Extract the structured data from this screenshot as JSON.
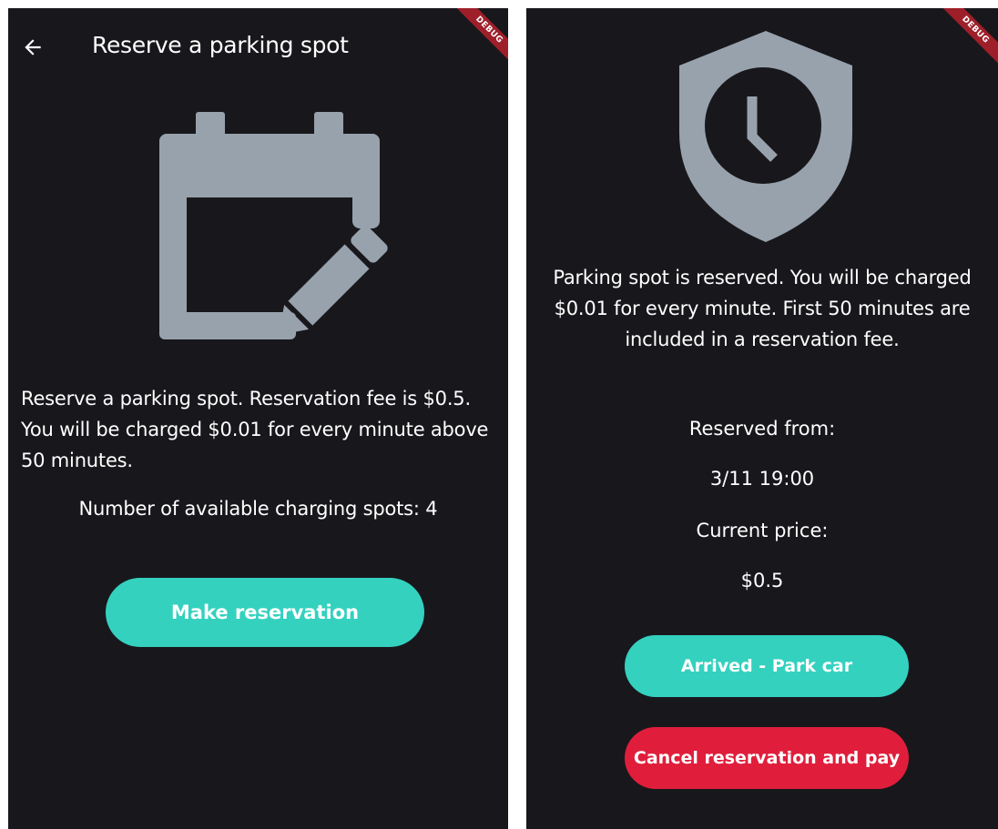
{
  "left_screen": {
    "debug_banner": "DEBUG",
    "title": "Reserve a parking spot",
    "description": "Reserve a parking spot. Reservation fee is $0.5. You will be charged $0.01 for every minute above 50 minutes.",
    "available_spots": "Number of available charging spots: 4",
    "make_reservation_label": "Make reservation",
    "icons": {
      "back": "arrow-back-icon",
      "hero": "calendar-edit-icon"
    }
  },
  "right_screen": {
    "debug_banner": "DEBUG",
    "message": "Parking spot is reserved. You will be charged $0.01 for every minute. First 50 minutes are included in a reservation fee.",
    "reserved_from_label": "Reserved from:",
    "reserved_from_value": "3/11 19:00",
    "current_price_label": "Current price:",
    "current_price_value": "$0.5",
    "arrived_label": "Arrived - Park car",
    "cancel_label": "Cancel reservation and pay",
    "icons": {
      "hero": "shield-clock-icon"
    }
  },
  "colors": {
    "background": "#18181c",
    "icon_gray": "#98a2ad",
    "primary_teal": "#34d1bf",
    "danger_red": "#e01e3c",
    "debug_ribbon": "#9e1f2a"
  }
}
